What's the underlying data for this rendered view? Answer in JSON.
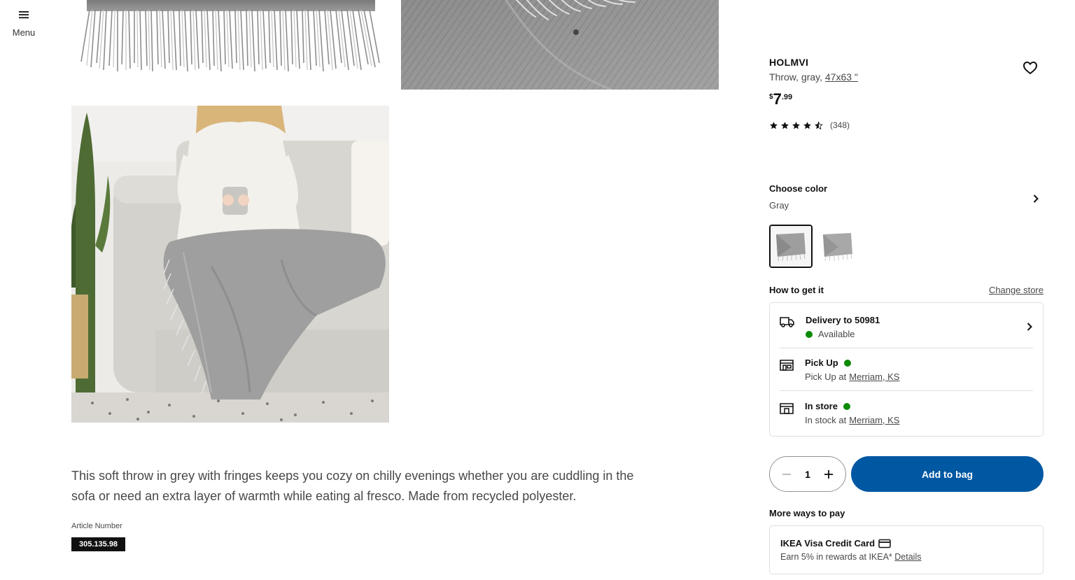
{
  "menu": {
    "label": "Menu",
    "icon": "hamburger-icon"
  },
  "product": {
    "name": "HOLMVI",
    "description_prefix": "Throw, gray,",
    "size_link": "47x63 \"",
    "price_currency": "$",
    "price_integer": "7",
    "price_decimal": ".99",
    "rating_value": 4.5,
    "rating_max": 5,
    "review_count": "(348)"
  },
  "color": {
    "title": "Choose color",
    "value": "Gray",
    "swatches": [
      {
        "name": "Gray",
        "selected": true
      },
      {
        "name": "Gray/white",
        "selected": false
      }
    ]
  },
  "how_to_get": {
    "title": "How to get it",
    "change_store": "Change store",
    "options": [
      {
        "title": "Delivery to 50981",
        "status": "Available",
        "icon": "truck-icon"
      },
      {
        "title": "Pick Up",
        "subtitle": "Pick Up at",
        "location": "Merriam, KS",
        "icon": "pickup-store-icon"
      },
      {
        "title": "In store",
        "subtitle": "In stock at",
        "location": "Merriam, KS",
        "icon": "store-icon"
      }
    ],
    "status_color": "#0a8a00"
  },
  "purchase": {
    "quantity": "1",
    "add_to_bag": "Add to bag",
    "accent_color": "#0058a3"
  },
  "payment": {
    "title": "More ways to pay",
    "card_title": "IKEA Visa Credit Card",
    "card_subtitle": "Earn 5% in rewards at IKEA*",
    "card_link": "Details"
  },
  "details": {
    "description": "This soft throw in grey with fringes keeps you cozy on chilly evenings whether you are cuddling in the sofa or need an extra layer of warmth while eating al fresco. Made from recycled polyester.",
    "article_label": "Article Number",
    "article_number": "305.135.98"
  }
}
